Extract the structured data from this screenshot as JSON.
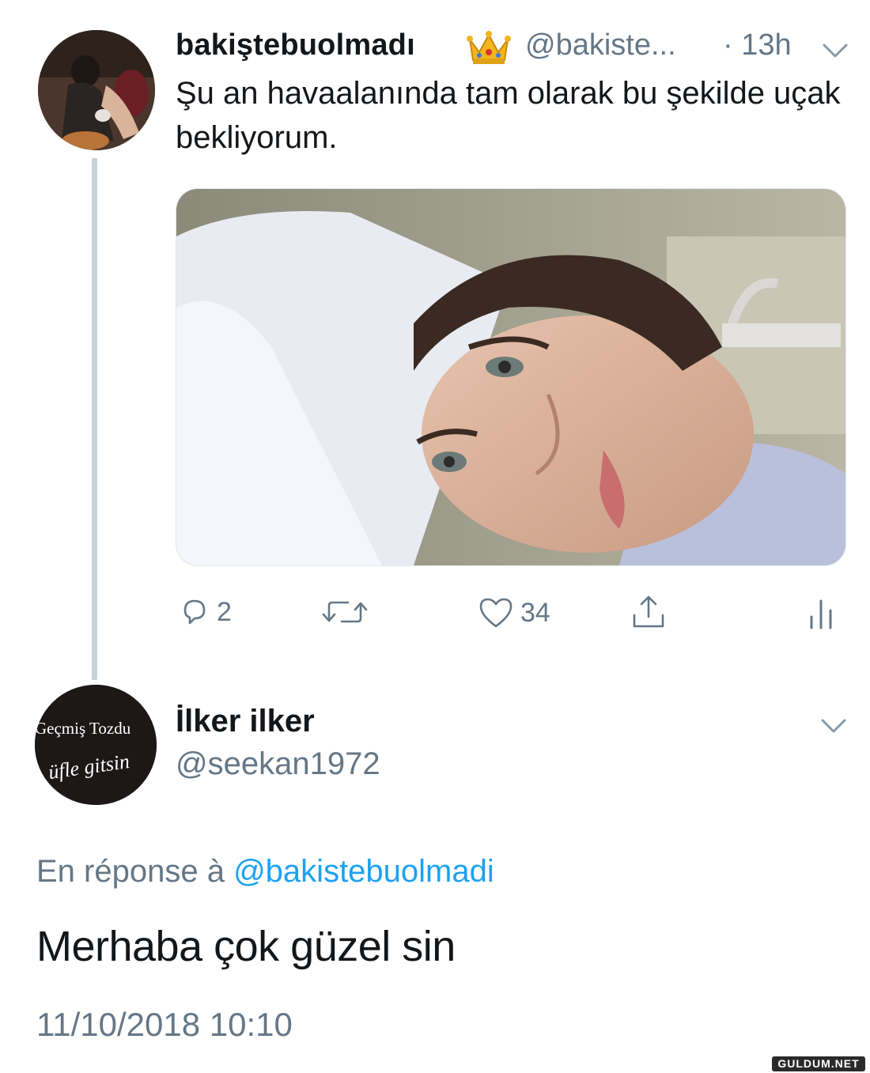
{
  "tweet": {
    "display_name": "bakiştebuolmadı",
    "handle": "@bakiste...",
    "time": "· 13h",
    "text": "Şu an havaalanında tam olarak bu şekilde uçak bekliyorum.",
    "reply_count": "2",
    "like_count": "34"
  },
  "reply": {
    "display_name": "İlker ilker",
    "handle": "@seekan1972",
    "avatar_text_line1": "Geçmiş Tozdu",
    "avatar_text_line2": "üfle gitsin",
    "reply_prefix": "En réponse à",
    "reply_mention": "@bakistebuolmadi",
    "text": "Merhaba çok güzel sin",
    "timestamp": "11/10/2018 10:10"
  },
  "watermark": "GULDUM.NET",
  "colors": {
    "text": "#14171a",
    "secondary": "#657786",
    "link": "#1da1f2",
    "thread_line": "#c7d1d8"
  },
  "icons": [
    "crown-icon",
    "caret-down-icon",
    "reply-icon",
    "retweet-icon",
    "like-icon",
    "share-icon",
    "analytics-icon"
  ]
}
